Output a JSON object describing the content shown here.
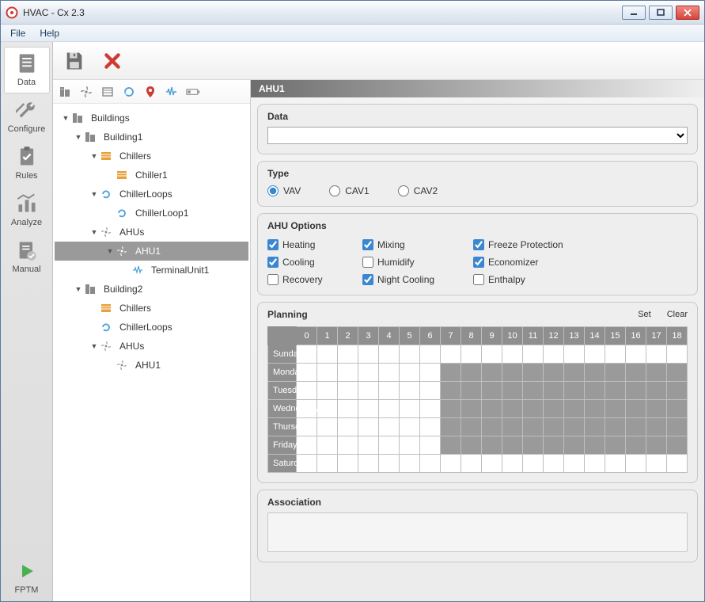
{
  "window": {
    "title": "HVAC - Cx 2.3"
  },
  "menu": {
    "file": "File",
    "help": "Help"
  },
  "leftnav": {
    "data": "Data",
    "configure": "Configure",
    "rules": "Rules",
    "analyze": "Analyze",
    "manual": "Manual",
    "fptm": "FPTM"
  },
  "tree": {
    "root": "Buildings",
    "b1": "Building1",
    "b1_chillers": "Chillers",
    "b1_chiller1": "Chiller1",
    "b1_loops": "ChillerLoops",
    "b1_loop1": "ChillerLoop1",
    "b1_ahus": "AHUs",
    "b1_ahu1": "AHU1",
    "b1_tu1": "TerminalUnit1",
    "b2": "Building2",
    "b2_chillers": "Chillers",
    "b2_loops": "ChillerLoops",
    "b2_ahus": "AHUs",
    "b2_ahu1": "AHU1"
  },
  "detail": {
    "title": "AHU1",
    "panels": {
      "data": "Data",
      "type": "Type",
      "options": "AHU Options",
      "planning": "Planning",
      "association": "Association"
    },
    "type_options": {
      "vav": "VAV",
      "cav1": "CAV1",
      "cav2": "CAV2",
      "selected": "vav"
    },
    "ahu_options": {
      "heating": {
        "label": "Heating",
        "checked": true
      },
      "cooling": {
        "label": "Cooling",
        "checked": true
      },
      "recovery": {
        "label": "Recovery",
        "checked": false
      },
      "mixing": {
        "label": "Mixing",
        "checked": true
      },
      "humidify": {
        "label": "Humidify",
        "checked": false
      },
      "nightcool": {
        "label": "Night Cooling",
        "checked": true
      },
      "freeze": {
        "label": "Freeze Protection",
        "checked": true
      },
      "econ": {
        "label": "Economizer",
        "checked": true
      },
      "enthalpy": {
        "label": "Enthalpy",
        "checked": false
      }
    },
    "planning": {
      "set": "Set",
      "clear": "Clear",
      "hours": [
        "0",
        "1",
        "2",
        "3",
        "4",
        "5",
        "6",
        "7",
        "8",
        "9",
        "10",
        "11",
        "12",
        "13",
        "14",
        "15",
        "16",
        "17",
        "18"
      ],
      "days": [
        {
          "name": "Sunday",
          "on_from": null
        },
        {
          "name": "Monday",
          "on_from": 7
        },
        {
          "name": "Tuesday",
          "on_from": 7
        },
        {
          "name": "Wednesday",
          "on_from": 7
        },
        {
          "name": "Thursday",
          "on_from": 7
        },
        {
          "name": "Friday",
          "on_from": 7
        },
        {
          "name": "Saturday",
          "on_from": null
        }
      ]
    }
  }
}
